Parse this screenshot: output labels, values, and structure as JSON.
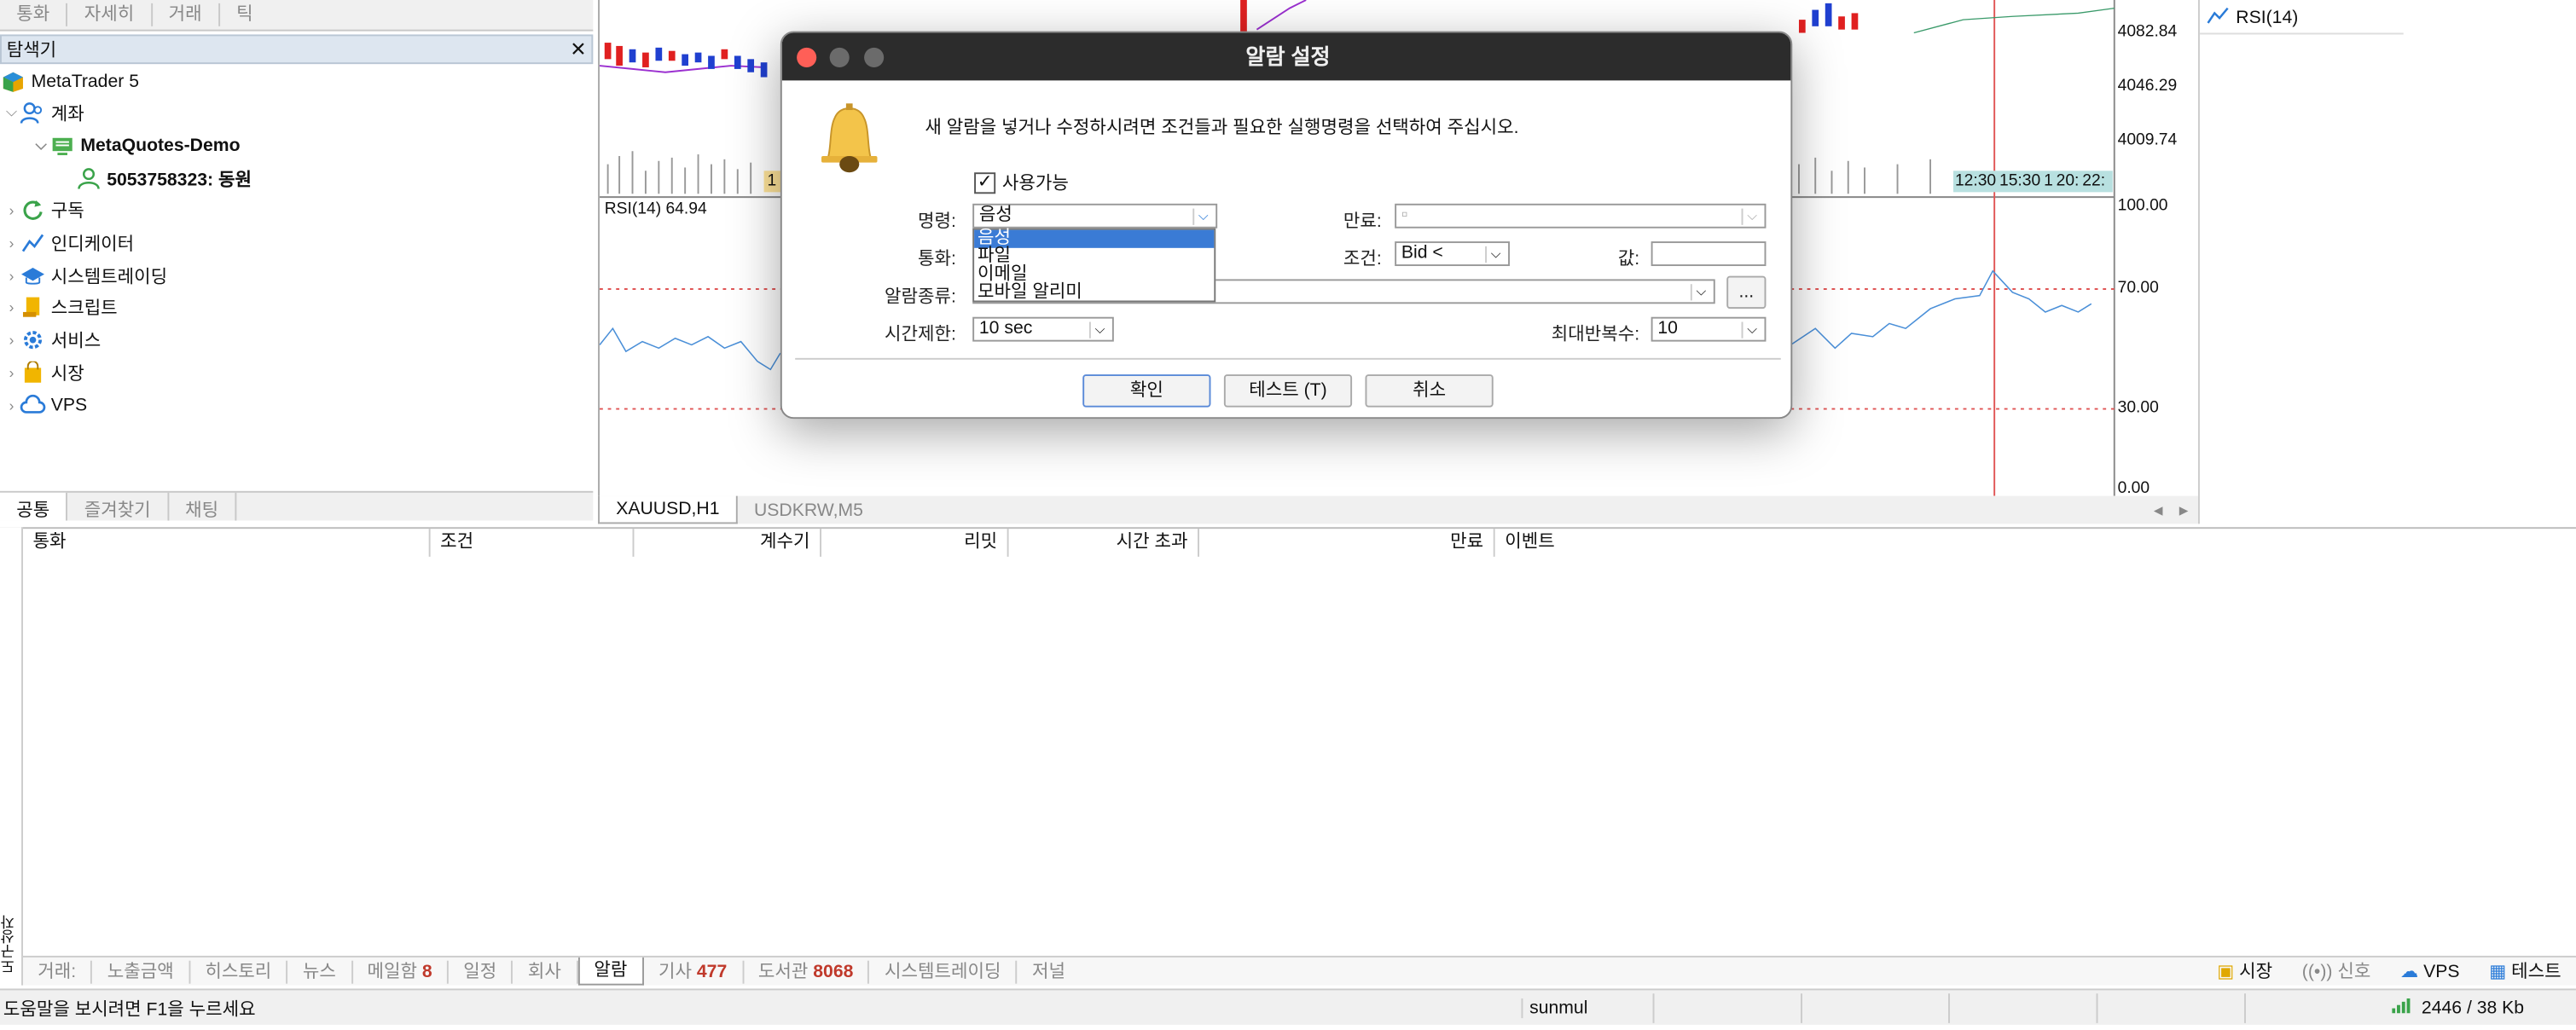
{
  "top_tabs": [
    "통화",
    "자세히",
    "거래",
    "틱"
  ],
  "navigator": {
    "title": "탐색기",
    "close": "✕",
    "items": {
      "root": "MetaTrader 5",
      "accounts": "계좌",
      "server": "MetaQuotes-Demo",
      "account": "5053758323: 동원",
      "subscriptions": "구독",
      "indicators": "인디케이터",
      "trading": "시스템트레이딩",
      "scripts": "스크립트",
      "services": "서비스",
      "market": "시장",
      "vps": "VPS"
    },
    "tabs": [
      "공통",
      "즐겨찾기",
      "채팅"
    ]
  },
  "chart": {
    "prices": [
      "4082.84",
      "4046.29",
      "4009.74"
    ],
    "rsi_label": "RSI(14) 64.94",
    "rsi_levels": [
      "100.00",
      "70.00",
      "30.00",
      "0.00"
    ],
    "time_labels": [
      "12:30",
      "15:30",
      "1",
      "20:",
      "22:"
    ],
    "date_label": "1",
    "tabs": [
      "XAUUSD,H1",
      "USDKRW,M5"
    ],
    "scroll_left": "◂",
    "scroll_right": "▸"
  },
  "right_panel": {
    "item": "RSI(14)"
  },
  "toolbox": {
    "columns": [
      "통화",
      "조건",
      "계수기",
      "리밋",
      "시간 초과",
      "만료",
      "이벤트"
    ],
    "side_title": "도구상자",
    "tabs": [
      "거래:",
      "노출금액",
      "히스토리",
      "뉴스",
      "메일함",
      "일정",
      "회사",
      "알람",
      "기사",
      "도서관",
      "시스템트레이딩",
      "저널"
    ],
    "mail_count": "8",
    "articles_count": "477",
    "library_count": "8068",
    "right_tabs": [
      "시장",
      "신호",
      "VPS",
      "테스트"
    ]
  },
  "status": {
    "help": "도움말을 보시려면 F1을 누르세요",
    "profile": "sunmul",
    "connection": "2446 / 38 Kb"
  },
  "dialog": {
    "title": "알람 설정",
    "desc": "새 알람을 넣거나 수정하시려면 조건들과 필요한 실행명령을 선택하여 주십시오.",
    "enabled": "사용가능",
    "action_label": "명령:",
    "action_value": "음성",
    "symbol_label": "통화:",
    "type_label": "알람종류:",
    "timeout_label": "시간제한:",
    "timeout_value": "10 sec",
    "expiry_label": "만료:",
    "condition_label": "조건:",
    "condition_value": "Bid <",
    "value_label": "값:",
    "max_label": "최대반복수:",
    "max_value": "10",
    "browse": "...",
    "ok": "확인",
    "test": "테스트 (T)",
    "cancel": "취소",
    "options": [
      "음성",
      "파일",
      "이메일",
      "모바일 알리미"
    ]
  }
}
